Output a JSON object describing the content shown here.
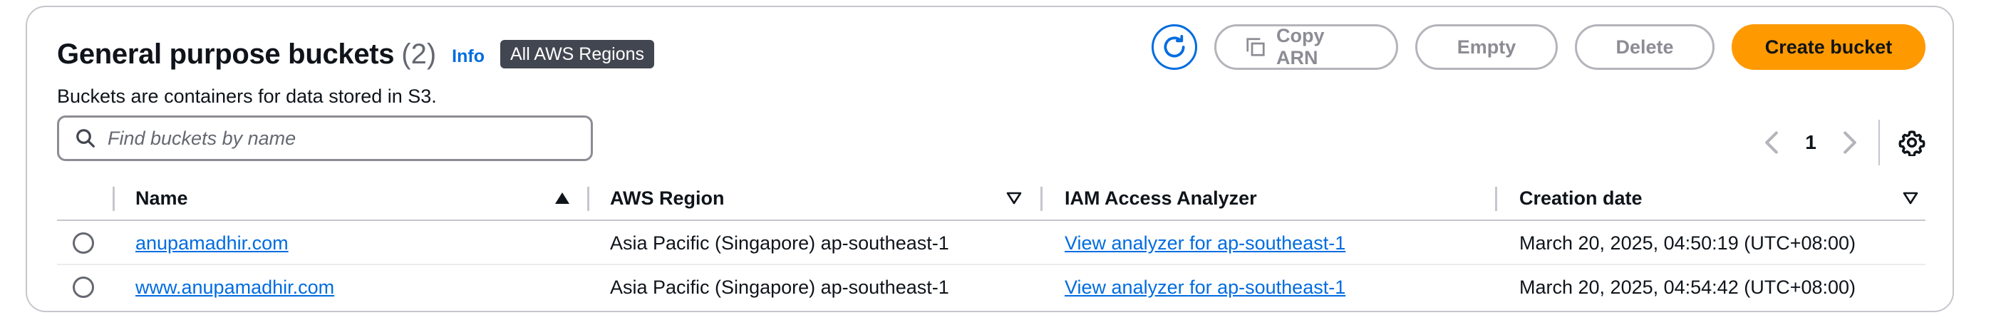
{
  "header": {
    "title": "General purpose buckets",
    "count": "(2)",
    "info_link": "Info",
    "region_badge": "All AWS Regions",
    "description": "Buckets are containers for data stored in S3."
  },
  "actions": {
    "refresh_icon": "refresh-icon",
    "copy_arn": "Copy ARN",
    "empty": "Empty",
    "delete": "Delete",
    "create_bucket": "Create bucket"
  },
  "search": {
    "placeholder": "Find buckets by name",
    "value": ""
  },
  "pagination": {
    "current_page": "1"
  },
  "table": {
    "columns": {
      "name": "Name",
      "region": "AWS Region",
      "analyzer": "IAM Access Analyzer",
      "created": "Creation date"
    },
    "rows": [
      {
        "name": "anupamadhir.com",
        "region": "Asia Pacific (Singapore) ap-southeast-1",
        "analyzer": "View analyzer for ap-southeast-1",
        "created": "March 20, 2025, 04:50:19 (UTC+08:00)"
      },
      {
        "name": "www.anupamadhir.com",
        "region": "Asia Pacific (Singapore) ap-southeast-1",
        "analyzer": "View analyzer for ap-southeast-1",
        "created": "March 20, 2025, 04:54:42 (UTC+08:00)"
      }
    ]
  },
  "colors": {
    "primary_button": "#ff9900",
    "link": "#006ce0",
    "badge": "#424650"
  }
}
